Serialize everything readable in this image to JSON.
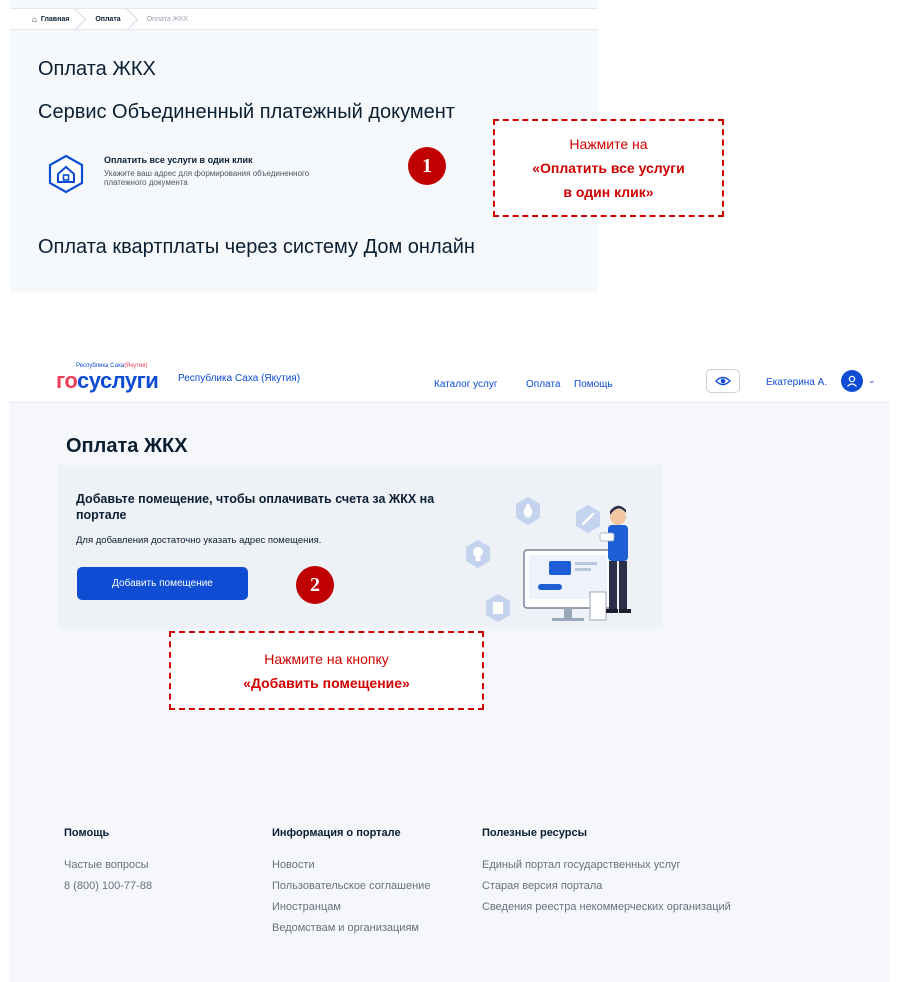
{
  "shot1": {
    "breadcrumb": [
      "Главная",
      "Оплата",
      "Оплата ЖКХ"
    ],
    "title": "Оплата ЖКХ",
    "service_title": "Сервис Объединенный платежный документ",
    "service_link": "Оплатить все услуги в один клик",
    "service_subtitle": "Укажите ваш адрес для формирования объединенного платежного документа",
    "dom_online": "Оплата квартплаты через систему Дом онлайн"
  },
  "steps": [
    "1",
    "2"
  ],
  "callout1": {
    "line1": "Нажмите на",
    "line2": "«Оплатить все услуги",
    "line3": "в один клик»"
  },
  "callout2": {
    "line1": "Нажмите на кнопку",
    "line2": "«Добавить помещение»"
  },
  "shot2": {
    "logo_small_blue": "Республика Саха",
    "logo_small_red": "(Якутия)",
    "logo_main_red": "го",
    "logo_main_blue": "суслуги",
    "region": "Республика Саха (Якутия)",
    "nav": {
      "catalog": "Каталог услуг",
      "pay": "Оплата",
      "help": "Помощь"
    },
    "user_name": "Екатерина А.",
    "page_title": "Оплата ЖКХ",
    "card": {
      "title": "Добавьте помещение, чтобы оплачивать счета за ЖКХ на портале",
      "text": "Для добавления достаточно указать адрес помещения.",
      "button": "Добавить помещение"
    },
    "footer": {
      "col1": {
        "title": "Помощь",
        "items": [
          "Частые вопросы",
          "8 (800) 100-77-88"
        ]
      },
      "col2": {
        "title": "Информация о портале",
        "items": [
          "Новости",
          "Пользовательское соглашение",
          "Иностранцам",
          "Ведомствам и организациям"
        ]
      },
      "col3": {
        "title": "Полезные ресурсы",
        "items": [
          "Единый портал государственных услуг",
          "Старая версия портала",
          "Сведения реестра некоммерческих организаций"
        ]
      }
    }
  },
  "colors": {
    "brand_blue": "#0d4cd3",
    "brand_red": "#ee3f58",
    "callout_red": "#d00000",
    "step_red": "#c00000"
  }
}
